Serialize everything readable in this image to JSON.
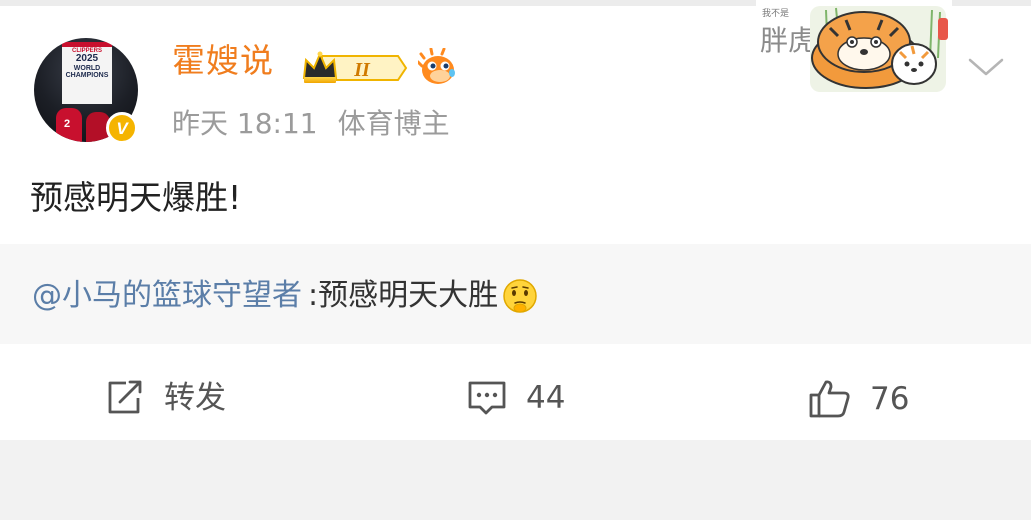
{
  "post": {
    "username": "霍嫂说",
    "level_badge": "II",
    "time": "昨天 18:11",
    "source": "体育博主",
    "text": "预感明天爆胜!"
  },
  "avatar": {
    "banner_line1": "CLIPPERS",
    "banner_line2": "2025",
    "banner_line3": "WORLD",
    "banner_line4": "CHAMPIONS",
    "jersey_number": "2",
    "verified_mark": "V"
  },
  "sticker": {
    "small_text": "我不是",
    "big_text": "胖虎"
  },
  "retweet": {
    "mention": "@小马的篮球守望者",
    "text": " :预感明天大胜"
  },
  "actions": {
    "repost_label": "转发",
    "comment_count": "44",
    "like_count": "76"
  },
  "icons": {
    "repost": "share-external-icon",
    "comment": "comment-bubble-icon",
    "like": "thumbs-up-icon",
    "more": "chevron-down-icon",
    "emoji": "thinking-face-emoji",
    "crown": "crown-badge-icon",
    "fish": "pufferfish-icon"
  },
  "colors": {
    "username": "#f07d1e",
    "mention": "#5b7ea8",
    "verified": "#f5b400",
    "meta": "#9b9b9b"
  }
}
